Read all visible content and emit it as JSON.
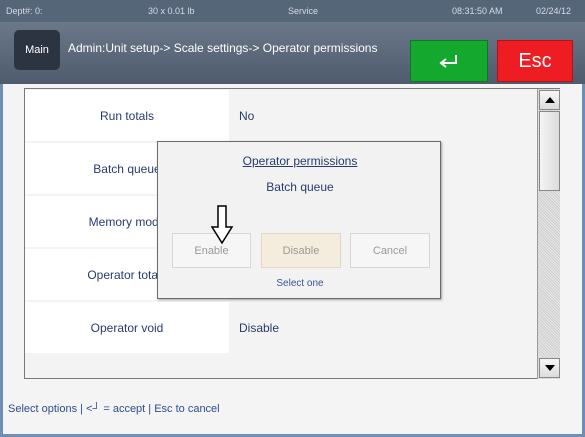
{
  "status": {
    "dept": "Dept#: 0:",
    "weight": "30 x 0.01 lb",
    "mode": "Service",
    "time": "08:31:50 AM",
    "date": "02/24/12"
  },
  "header": {
    "main_label": "Main",
    "breadcrumb": "Admin:Unit setup-> Scale settings-> Operator permissions",
    "esc_label": "Esc",
    "enter_icon": "enter-return-icon"
  },
  "rows": [
    {
      "label": "Run totals",
      "value": "No"
    },
    {
      "label": "Batch queue",
      "value": ""
    },
    {
      "label": "Memory mode",
      "value": ""
    },
    {
      "label": "Operator totals",
      "value": ""
    },
    {
      "label": "Operator void",
      "value": "Disable"
    }
  ],
  "dialog": {
    "title": "Operator permissions",
    "subtitle": "Batch queue",
    "enable_label": "Enable",
    "disable_label": "Disable",
    "cancel_label": "Cancel",
    "select_text": "Select one"
  },
  "footer": {
    "hint": "Select options | <┘ = accept | Esc to cancel"
  },
  "colors": {
    "accent_green": "#15a82f",
    "accent_red": "#ee1d23",
    "text_blue": "#283b6e"
  }
}
